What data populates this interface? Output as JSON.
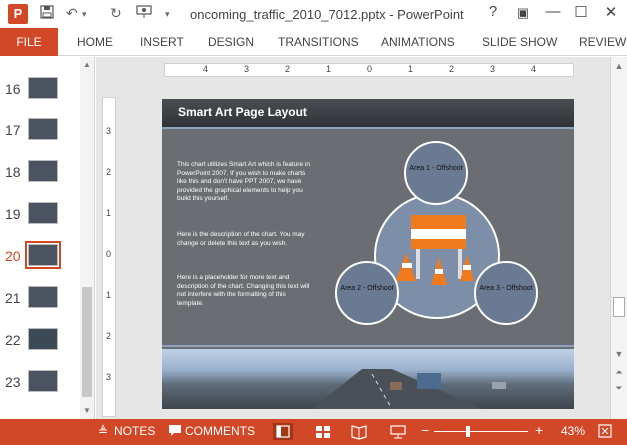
{
  "titlebar": {
    "app_logo": "P",
    "save_icon": "save-icon",
    "undo_icon": "undo-icon",
    "redo_icon": "redo-icon",
    "present_icon": "present-icon",
    "customize_icon": "customize-icon",
    "document_title": "oncoming_traffic_2010_7012.pptx - PowerPoint",
    "help": "?",
    "restore": "▣",
    "minimize": "—",
    "maximize": "☐",
    "close": "✕"
  },
  "ribbon": {
    "file": "FILE",
    "tabs": [
      "HOME",
      "INSERT",
      "DESIGN",
      "TRANSITIONS",
      "ANIMATIONS",
      "SLIDE SHOW",
      "REVIEW"
    ]
  },
  "thumbnails": {
    "items": [
      {
        "number": "16"
      },
      {
        "number": "17"
      },
      {
        "number": "18"
      },
      {
        "number": "19"
      },
      {
        "number": "20"
      },
      {
        "number": "21"
      },
      {
        "number": "22"
      },
      {
        "number": "23"
      }
    ],
    "selected_index": 4
  },
  "ruler": {
    "horizontal": [
      "4",
      "3",
      "2",
      "1",
      "0",
      "1",
      "2",
      "3",
      "4"
    ],
    "vertical": [
      "3",
      "2",
      "1",
      "0",
      "1",
      "2",
      "3"
    ]
  },
  "slide": {
    "title": "Smart Art Page Layout",
    "paragraph1": "This chart utilizes Smart Art which is feature in PowerPoint 2007.  If you wish to make charts like this and don't have PPT 2007, we have provided the graphical elements to help you build this yourself.",
    "paragraph2": "Here is the description of the chart. You may change or delete this text as you wish.",
    "paragraph3": "Here is a placeholder for more text and description of the chart.  Changing this text will not interfere with the formatting of this template.",
    "area1": "Area 1 - Offshoot",
    "area2": "Area 2 - Offshoot",
    "area3": "Area 3 - Offshoot"
  },
  "statusbar": {
    "notes": "NOTES",
    "comments": "COMMENTS",
    "zoom_minus": "−",
    "zoom_plus": "+",
    "zoom": "43%",
    "fit_icon": "fit-to-window-icon"
  }
}
